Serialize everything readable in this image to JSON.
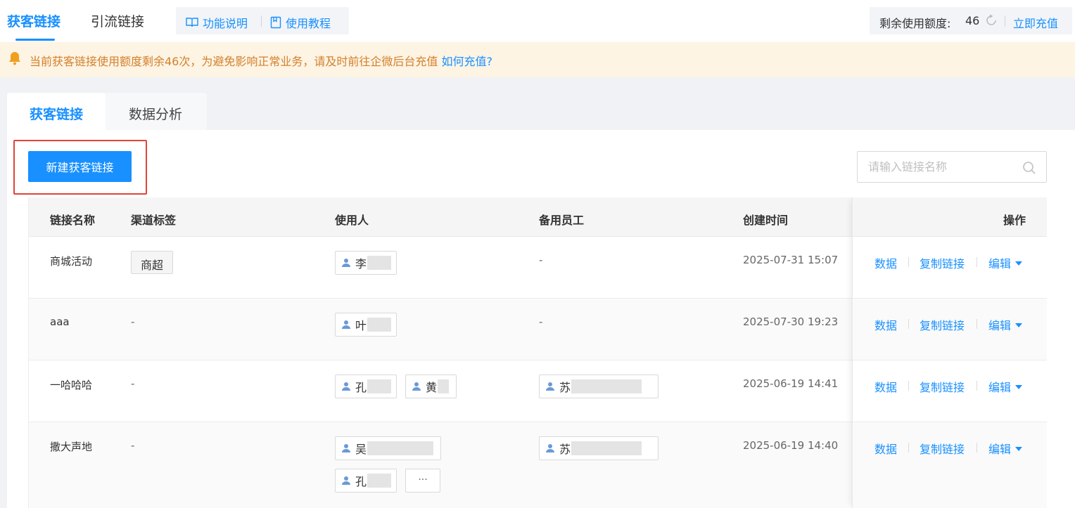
{
  "top_tabs": [
    {
      "label": "获客链接",
      "active": true
    },
    {
      "label": "引流链接",
      "active": false
    }
  ],
  "help": {
    "feature_label": "功能说明",
    "tutorial_label": "使用教程"
  },
  "quota": {
    "label": "剩余使用额度:",
    "value": "46",
    "recharge_label": "立即充值"
  },
  "notice": {
    "text": "当前获客链接使用额度剩余46次，为避免影响正常业务，请及时前往企微后台充值",
    "link": "如何充值?"
  },
  "content_tabs": [
    {
      "label": "获客链接",
      "active": true
    },
    {
      "label": "数据分析",
      "active": false
    }
  ],
  "toolbar": {
    "new_button": "新建获客链接",
    "search_placeholder": "请输入链接名称"
  },
  "table": {
    "columns": {
      "name": "链接名称",
      "channel": "渠道标签",
      "users": "使用人",
      "backup": "备用员工",
      "created": "创建时间",
      "actions": "操作"
    },
    "actions": {
      "data": "数据",
      "copy": "复制链接",
      "edit": "编辑"
    },
    "rows": [
      {
        "name": "商城活动",
        "channel": "商超",
        "users": [
          "李"
        ],
        "backup": "-",
        "created": "2025-07-31 15:07"
      },
      {
        "name": "aaa",
        "channel": "-",
        "users": [
          "叶"
        ],
        "backup": "-",
        "created": "2025-07-30 19:23"
      },
      {
        "name": "一哈哈哈",
        "channel": "-",
        "users": [
          "孔",
          "黄"
        ],
        "backup": "苏",
        "created": "2025-06-19 14:41"
      },
      {
        "name": "撒大声地",
        "channel": "-",
        "users": [
          "吴",
          "孔"
        ],
        "backup": "苏",
        "created": "2025-06-19 14:40",
        "more": "···"
      }
    ]
  },
  "colors": {
    "primary": "#1890ff",
    "warning_text": "#d4802b",
    "warning_bg": "#fdf4e4",
    "highlight_border": "#e0443a"
  }
}
